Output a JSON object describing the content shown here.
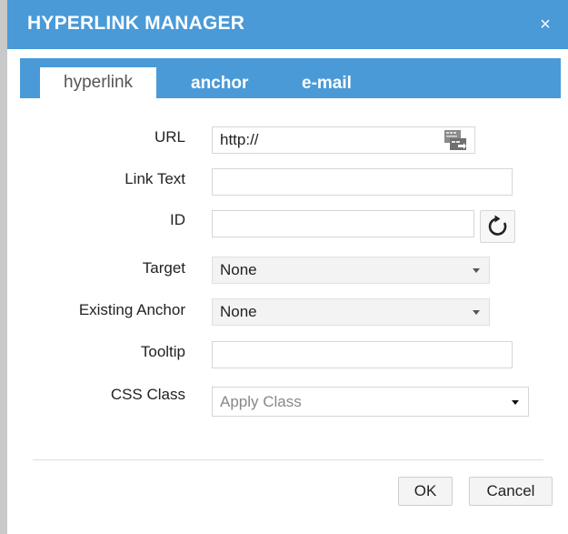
{
  "dialog": {
    "title": "HYPERLINK MANAGER",
    "close_symbol": "×"
  },
  "tabs": [
    {
      "label": "hyperlink",
      "active": true
    },
    {
      "label": "anchor",
      "active": false
    },
    {
      "label": "e-mail",
      "active": false
    }
  ],
  "form": {
    "url": {
      "label": "URL",
      "value": "http://"
    },
    "link_text": {
      "label": "Link Text",
      "value": ""
    },
    "id": {
      "label": "ID",
      "value": ""
    },
    "target": {
      "label": "Target",
      "selected": "None"
    },
    "existing_anchor": {
      "label": "Existing Anchor",
      "selected": "None"
    },
    "tooltip": {
      "label": "Tooltip",
      "value": ""
    },
    "css_class": {
      "label": "CSS Class",
      "selected": "Apply Class"
    }
  },
  "icons": {
    "browse": "document-manager-icon",
    "refresh": "refresh-icon"
  },
  "buttons": {
    "ok": "OK",
    "cancel": "Cancel"
  },
  "colors": {
    "accent": "#4a9ad8"
  }
}
